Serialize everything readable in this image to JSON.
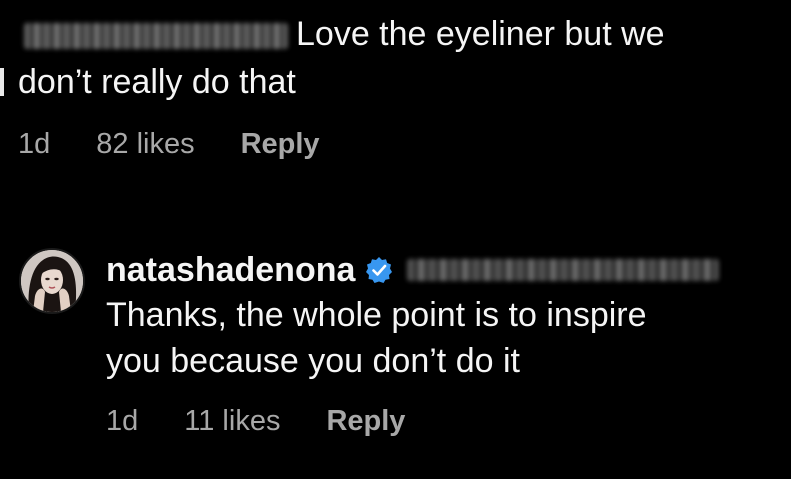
{
  "comment": {
    "username_redacted": true,
    "text_line1": "Love the eyeliner but we",
    "text_line2": "don’t really do that",
    "time": "1d",
    "likes": "82 likes",
    "reply_label": "Reply"
  },
  "reply": {
    "username": "natashadenona",
    "verified": true,
    "mention_redacted": true,
    "text_line1": "Thanks, the whole point is to inspire",
    "text_line2": "you because you don’t do it",
    "time": "1d",
    "likes": "11 likes",
    "reply_label": "Reply"
  },
  "colors": {
    "background": "#000000",
    "text": "#f5f5f5",
    "meta": "#a8a8a8",
    "verified_badge": "#3897f0"
  }
}
